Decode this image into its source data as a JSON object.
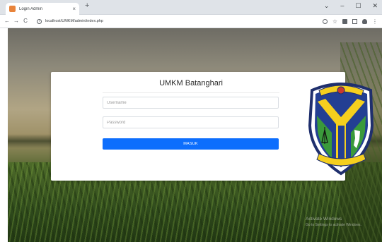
{
  "browser": {
    "tab_title": "Login Admin",
    "tab_close": "×",
    "new_tab": "+",
    "window_controls": [
      "⌄",
      "–",
      "☐",
      "✕"
    ],
    "nav": {
      "back": "←",
      "forward": "→",
      "reload": "C"
    },
    "url": "localhost/UMKM/admin/index.php"
  },
  "login": {
    "title": "UMKM Batanghari",
    "username_placeholder": "Username",
    "password_placeholder": "Password",
    "submit_label": "MASUK"
  },
  "logo": {
    "top_text": "SEPUCUK JAMBI",
    "bottom_text": "SERENTAK BAK REGAM",
    "colors": {
      "blue": "#233f93",
      "yellow": "#f5cf1e",
      "green": "#3a9a3b",
      "navy": "#1f2f6d"
    }
  },
  "watermark": {
    "title": "Activate Windows",
    "subtitle": "Go to Settings to activate Windows."
  }
}
